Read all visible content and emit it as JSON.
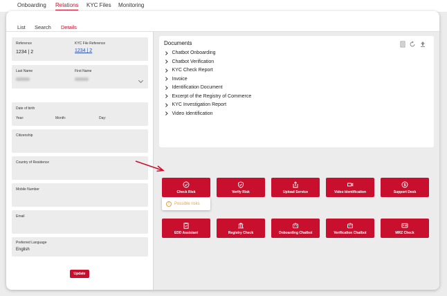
{
  "topnav": {
    "tabs": [
      {
        "label": "Onboarding"
      },
      {
        "label": "Relations"
      },
      {
        "label": "KYC Files"
      },
      {
        "label": "Monitoring"
      }
    ]
  },
  "subtabs": [
    {
      "label": "List"
    },
    {
      "label": "Search"
    },
    {
      "label": "Details"
    }
  ],
  "form": {
    "reference": {
      "label": "Reference",
      "value": "1234 | 2"
    },
    "kyc_file_reference": {
      "label": "KYC File Reference",
      "value": "1234 | 2"
    },
    "last_name": {
      "label": "Last Name"
    },
    "first_name": {
      "label": "First Name"
    },
    "date_of_birth": {
      "label": "Date of birth",
      "year": "Year:",
      "month": "Month:",
      "day": "Day:"
    },
    "citizenship": {
      "label": "Citizenship"
    },
    "country_of_residence": {
      "label": "Country of Residence"
    },
    "mobile_number": {
      "label": "Mobile Number"
    },
    "email": {
      "label": "Email"
    },
    "preferred_language": {
      "label": "Preferred Language",
      "value": "English"
    },
    "update_label": "Update"
  },
  "documents": {
    "title": "Documents",
    "items": [
      "Chatbot Onboarding",
      "Chatbot Verification",
      "KYC Check Report",
      "Invoice",
      "Identification Document",
      "Excerpt of the Registry of Commerce",
      "KYC Investigation Report",
      "Video Identification"
    ],
    "tools": [
      "list-icon",
      "refresh-icon",
      "upload-icon"
    ]
  },
  "actions": {
    "row1": [
      {
        "label": "Check Risk",
        "icon": "check-circle-icon"
      },
      {
        "label": "Verify Risk",
        "icon": "shield-check-icon"
      },
      {
        "label": "Upload Service",
        "icon": "upload-box-icon"
      },
      {
        "label": "Video Identification",
        "icon": "video-camera-icon"
      },
      {
        "label": "Support Desk",
        "icon": "support-icon"
      }
    ],
    "row2": [
      {
        "label": "EDD Assistant",
        "icon": "clipboard-icon"
      },
      {
        "label": "Registry Check",
        "icon": "building-icon"
      },
      {
        "label": "Onboarding Chatbot",
        "icon": "bot-icon"
      },
      {
        "label": "Verification Chatbot",
        "icon": "bot-icon"
      },
      {
        "label": "MRZ Check",
        "icon": "id-card-icon"
      }
    ]
  },
  "popover": {
    "text": "Possible risks",
    "icon": "warning-icon"
  },
  "colors": {
    "accent": "#c8102e",
    "warning": "#e8a33d",
    "link": "#2a4fa8"
  }
}
